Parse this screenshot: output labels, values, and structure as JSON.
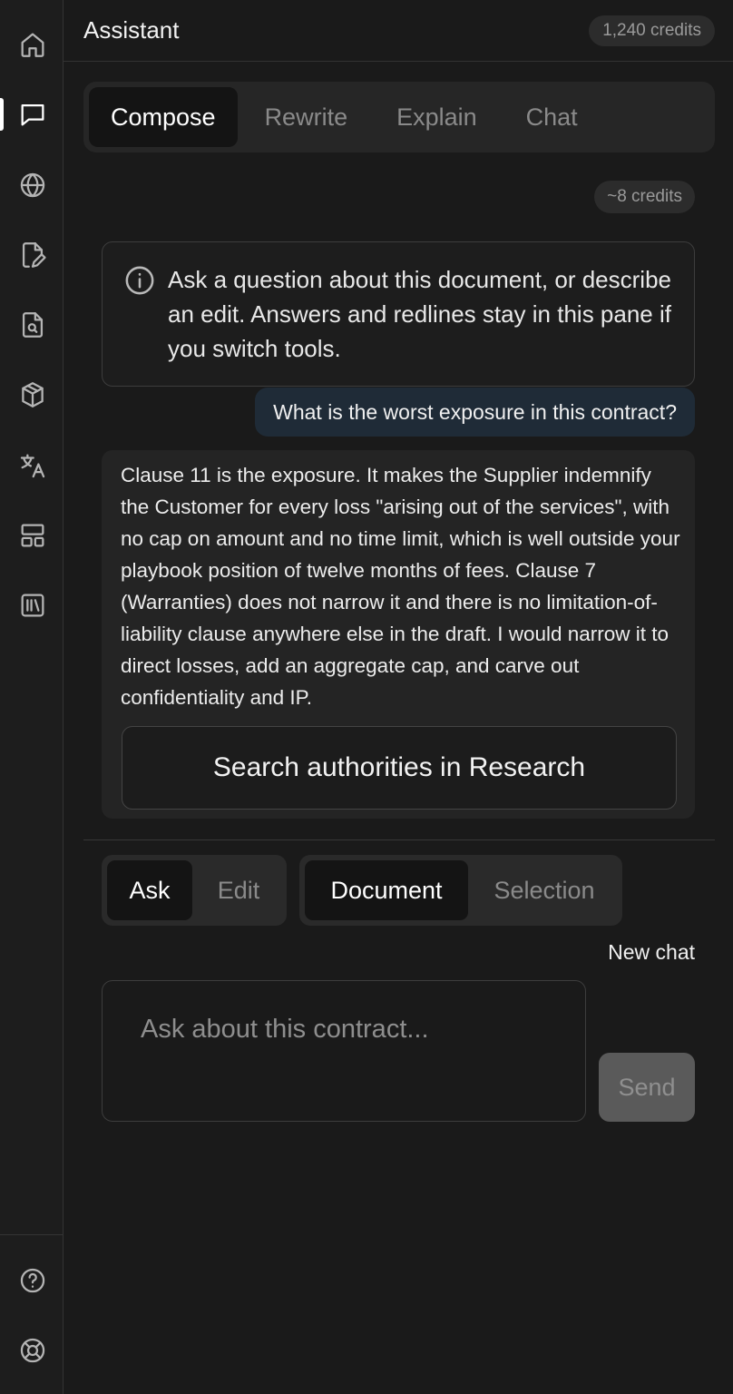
{
  "header": {
    "title": "Assistant",
    "credits": "1,240 credits"
  },
  "sidebar": {
    "items": [
      {
        "icon": "home-icon",
        "active": false
      },
      {
        "icon": "chat-bubble-icon",
        "active": true
      },
      {
        "icon": "globe-icon",
        "active": false
      },
      {
        "icon": "file-edit-icon",
        "active": false
      },
      {
        "icon": "file-search-icon",
        "active": false
      },
      {
        "icon": "cube-icon",
        "active": false
      },
      {
        "icon": "translate-icon",
        "active": false
      },
      {
        "icon": "layout-icon",
        "active": false
      },
      {
        "icon": "library-icon",
        "active": false
      }
    ],
    "footer": [
      {
        "icon": "help-icon"
      },
      {
        "icon": "lifebuoy-icon"
      }
    ]
  },
  "mode_tabs": {
    "items": [
      "Compose",
      "Rewrite",
      "Explain",
      "Chat"
    ],
    "active": "Compose"
  },
  "cost_estimate": "~8 credits",
  "info": {
    "icon": "info-icon",
    "text": "Ask a question about this document, or describe an edit. Answers and redlines stay in this pane if you switch tools."
  },
  "conversation": {
    "user_message": "What is the worst exposure in this contract?",
    "assistant_message": "Clause 11 is the exposure. It makes the Supplier indemnify the Customer for every loss \"arising out of the services\", with no cap on amount and no time limit, which is well outside your playbook position of twelve months of fees. Clause 7 (Warranties) does not narrow it and there is no limitation-of-liability clause anywhere else in the draft. I would narrow it to direct losses, add an aggregate cap, and carve out confidentiality and IP.",
    "action_button": "Search authorities in Research"
  },
  "controls": {
    "mode_toggle": {
      "options": [
        "Ask",
        "Edit"
      ],
      "active": "Ask"
    },
    "scope_toggle": {
      "options": [
        "Document",
        "Selection"
      ],
      "active": "Document"
    },
    "new_chat": "New chat"
  },
  "composer": {
    "placeholder": "Ask about this contract...",
    "value": "",
    "send_label": "Send",
    "send_enabled": false
  },
  "colors": {
    "background": "#1a1a1a",
    "rail": "#1d1d1d",
    "user_bubble": "#1f2b37",
    "answer_card": "#242424",
    "send_disabled": "#5a5a5a"
  }
}
